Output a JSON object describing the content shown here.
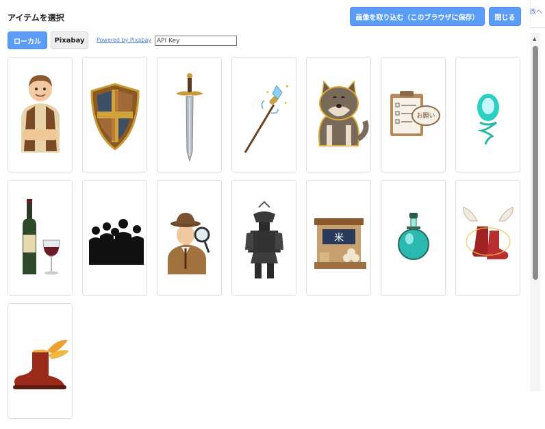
{
  "modal": {
    "title": "アイテムを選択",
    "import_button": "画像を取り込む（このブラウザに保存）",
    "close_button": "閉じる"
  },
  "tabs": [
    {
      "label": "ローカル",
      "active": true
    },
    {
      "label": "Pixabay",
      "active": false
    }
  ],
  "powered_by": "Powered by Pixabay",
  "api_key": {
    "placeholder": "API Key",
    "value": ""
  },
  "background_peek": "改へ",
  "colors": {
    "primary": "#5a9cf8",
    "link": "#4a7bd0"
  },
  "items": [
    {
      "name": "villager",
      "icon": "villager-icon"
    },
    {
      "name": "shield",
      "icon": "shield-icon"
    },
    {
      "name": "sword",
      "icon": "sword-icon"
    },
    {
      "name": "magic-staff",
      "icon": "staff-icon"
    },
    {
      "name": "wolf",
      "icon": "wolf-icon"
    },
    {
      "name": "request-clipboard",
      "icon": "clipboard-icon",
      "text": "お願い"
    },
    {
      "name": "spirit-orb",
      "icon": "orb-icon"
    },
    {
      "name": "wine",
      "icon": "wine-icon"
    },
    {
      "name": "silhouettes",
      "icon": "people-icon"
    },
    {
      "name": "detective",
      "icon": "detective-icon"
    },
    {
      "name": "samurai-armor",
      "icon": "samurai-icon"
    },
    {
      "name": "rice-shop",
      "icon": "shop-icon",
      "text": "米"
    },
    {
      "name": "potion",
      "icon": "potion-icon"
    },
    {
      "name": "winged-boots",
      "icon": "winged-boots-icon"
    },
    {
      "name": "winged-shoe",
      "icon": "winged-shoe-icon"
    }
  ]
}
